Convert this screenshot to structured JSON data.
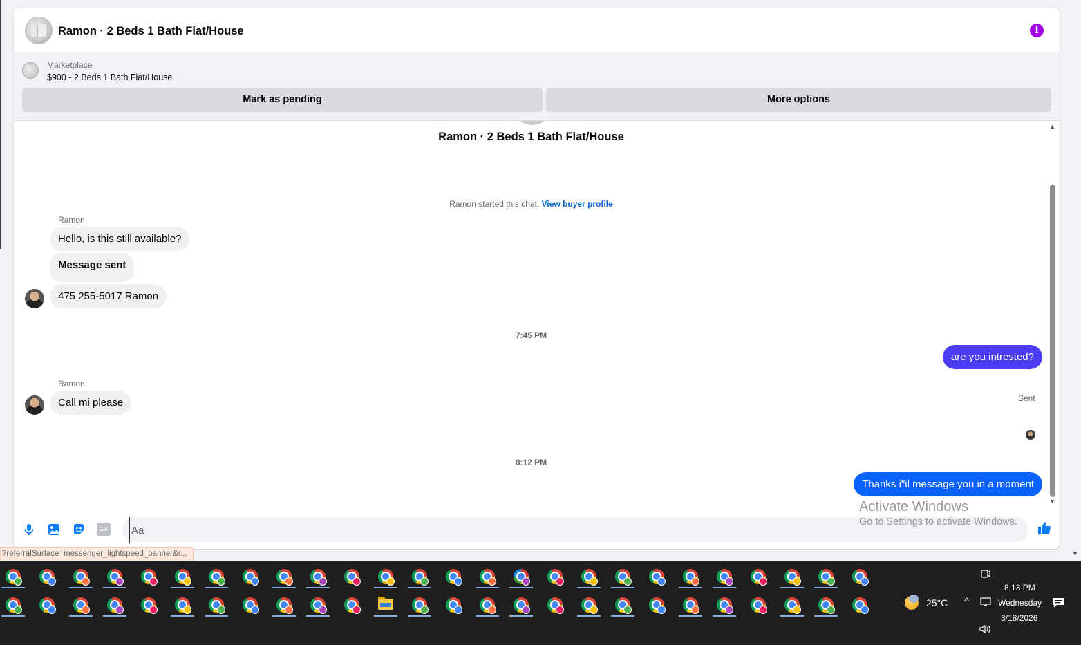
{
  "header": {
    "title": "Ramon · 2 Beds 1 Bath Flat/House"
  },
  "listing": {
    "source": "Marketplace",
    "summary": "$900 - 2 Beds 1 Bath Flat/House",
    "actions": {
      "mark_pending": "Mark as pending",
      "more_options": "More options"
    }
  },
  "thread": {
    "title": "Ramon · 2 Beds 1 Bath Flat/House",
    "system_text": "Ramon started this chat.",
    "system_link": "View buyer profile",
    "messages": [
      {
        "sender": "Ramon",
        "text": "Hello, is this still available?"
      },
      {
        "text": "Message sent"
      },
      {
        "text": "475 255-5017  Ramon"
      },
      {
        "timestamp": "7:45 PM"
      },
      {
        "text": "are you intrested?",
        "color": "#4a3cf2"
      },
      {
        "sender": "Ramon",
        "text": "Call mi please"
      },
      {
        "timestamp": "8:12 PM"
      },
      {
        "text": "Thanks i\"il message you in a moment",
        "color": "#0a62ff",
        "status": "Sent"
      }
    ]
  },
  "composer": {
    "placeholder": "Aa",
    "icons": [
      "microphone-icon",
      "image-icon",
      "sticker-icon",
      "gif-icon",
      "emoji-icon",
      "thumbs-up-icon"
    ],
    "gif_label": "GIF"
  },
  "watermark": {
    "title": "Activate Windows",
    "subtitle": "Go to Settings to activate Windows."
  },
  "status_bar": {
    "url": "?referralSurface=messenger_lightspeed_banner&r..."
  },
  "taskbar": {
    "weather": "25°C",
    "time": "8:13 PM",
    "day": "Wednesday",
    "date": "3/18/2026"
  },
  "colors": {
    "accent": "#0a7cff",
    "link": "#0064d1",
    "info": "#a200e6"
  }
}
